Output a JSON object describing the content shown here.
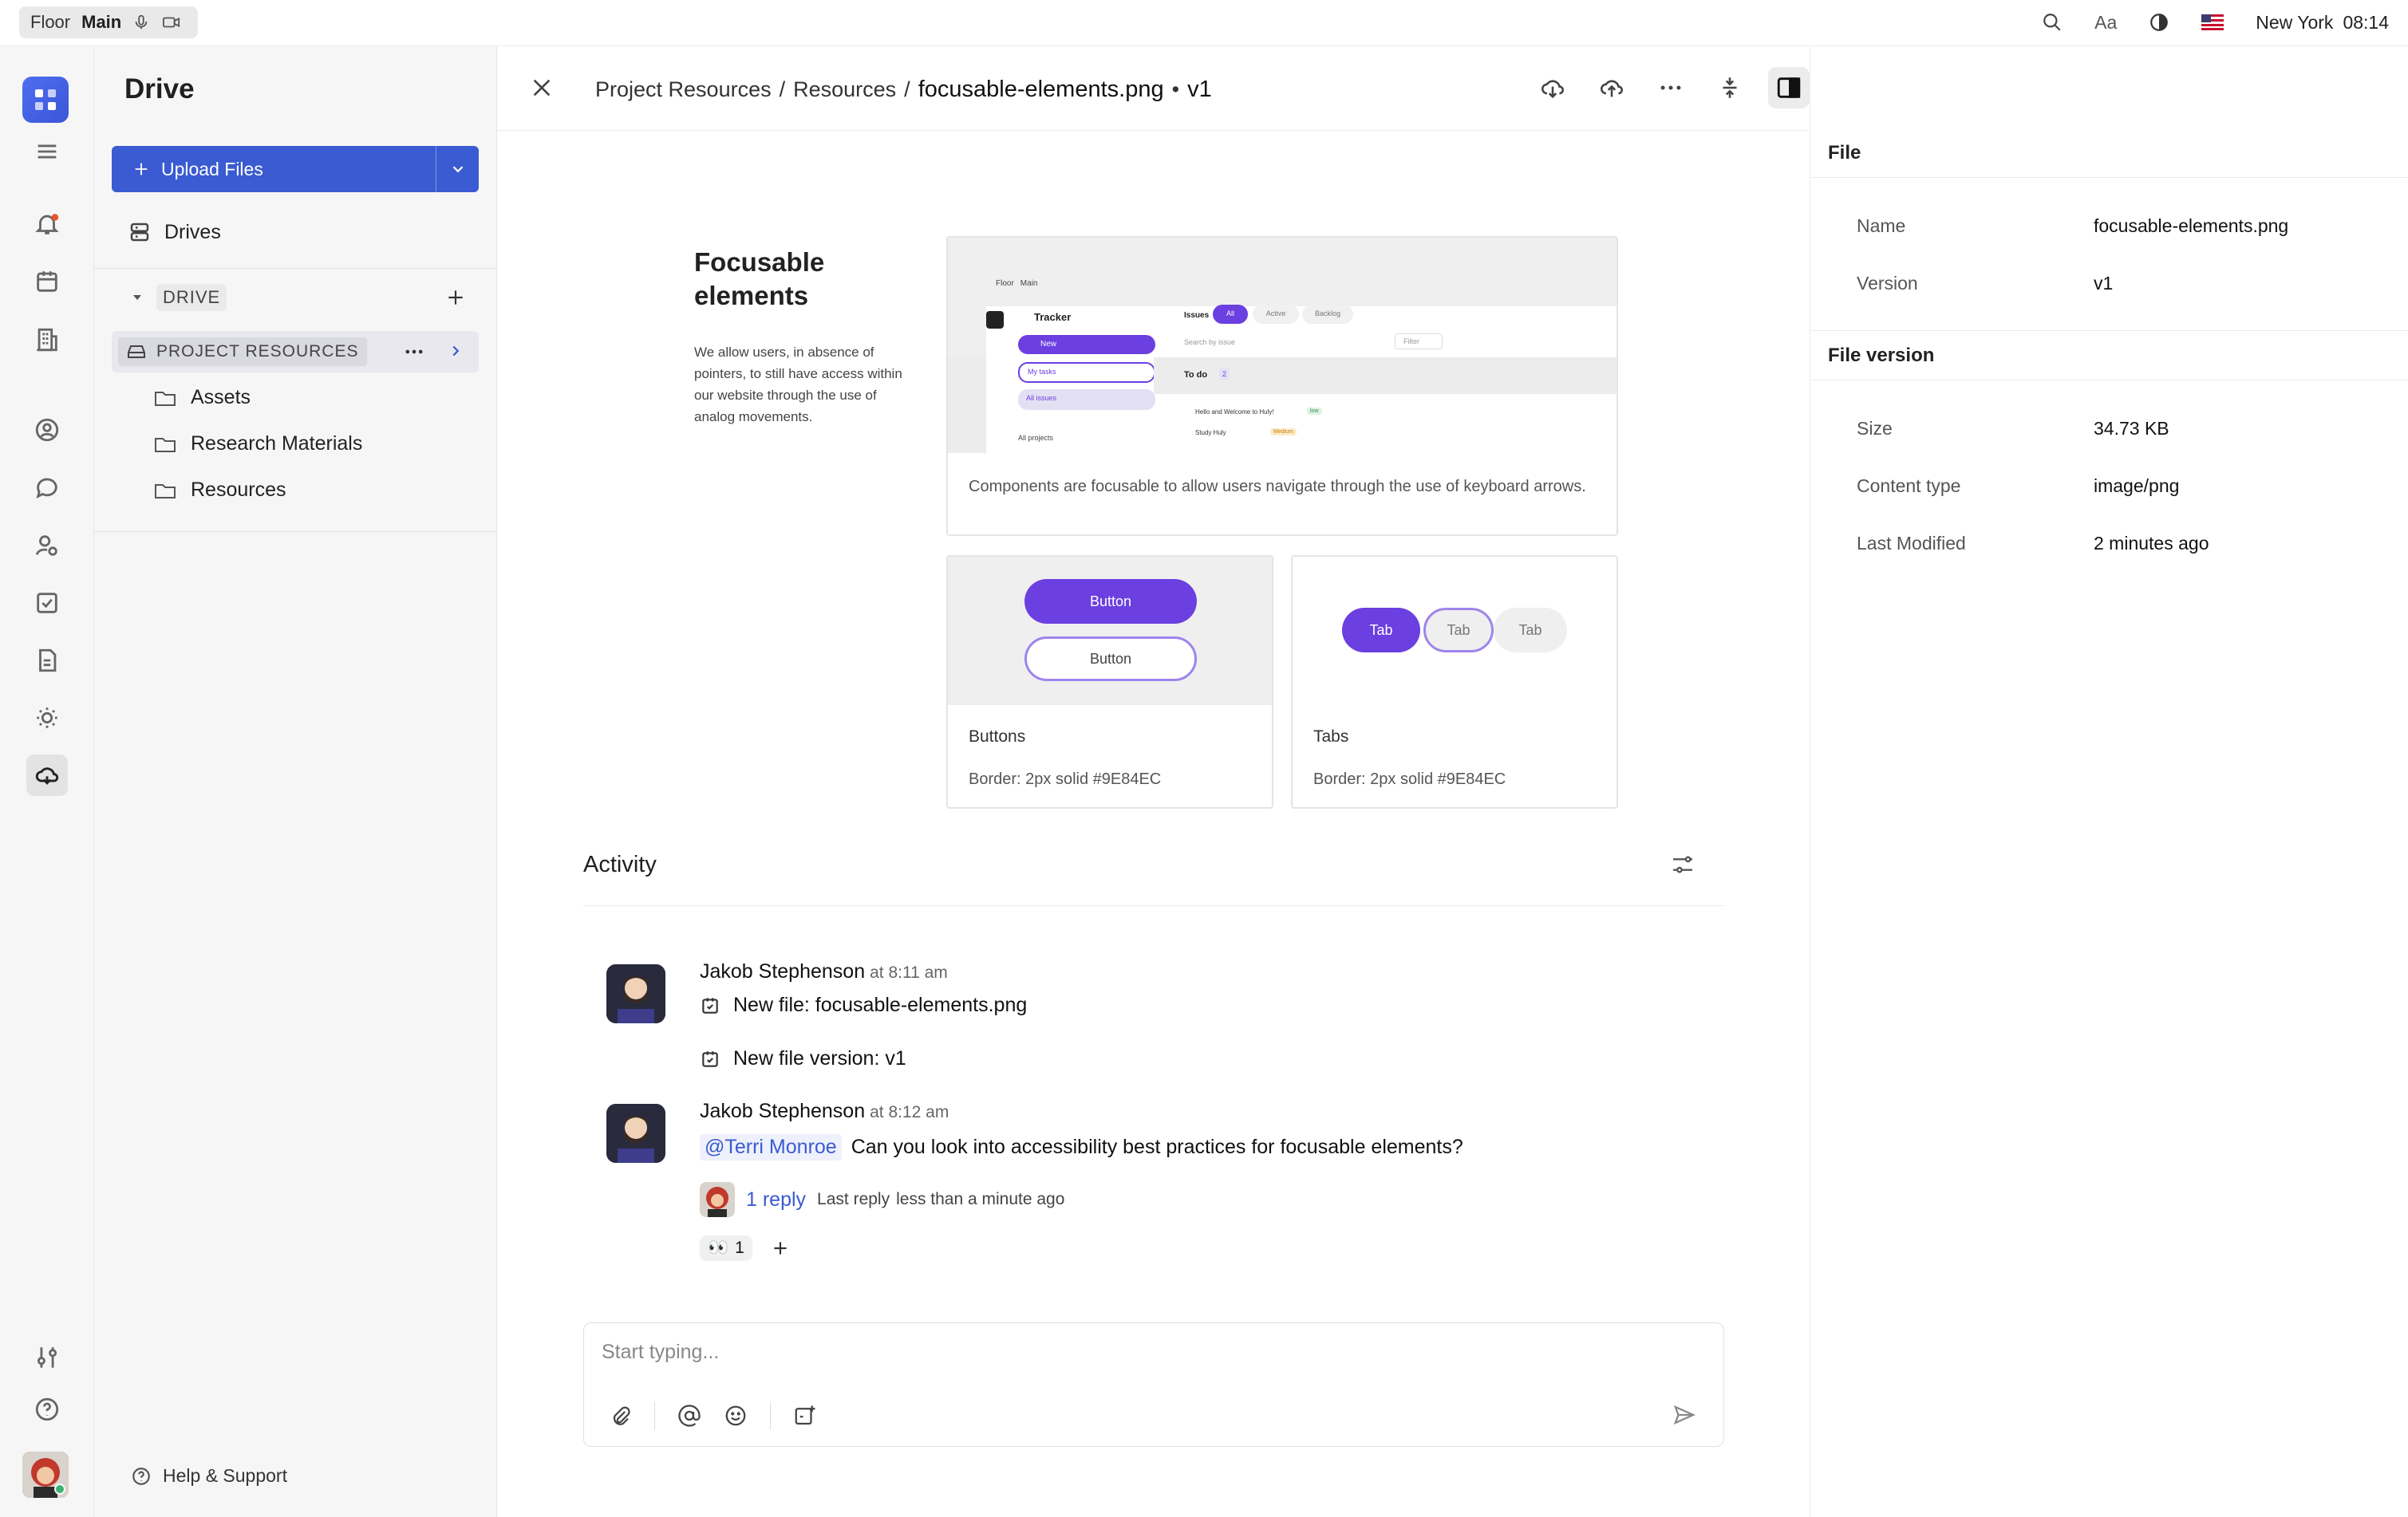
{
  "topbar": {
    "workspace": "Floor",
    "channel": "Main",
    "font_toggle": "Aa",
    "location": "New York",
    "time": "08:14"
  },
  "sidebar": {
    "title": "Drive",
    "upload_label": "Upload Files",
    "drives_label": "Drives",
    "drive_section": "DRIVE",
    "project": "PROJECT RESOURCES",
    "folders": [
      "Assets",
      "Research Materials",
      "Resources"
    ],
    "help": "Help & Support"
  },
  "header": {
    "crumb1": "Project Resources",
    "crumb2": "Resources",
    "filename": "focusable-elements.png",
    "version": "v1"
  },
  "preview": {
    "title_line1": "Focusable",
    "title_line2": "elements",
    "desc": "We allow users, in absence of pointers, to still have access within our website through the use of analog movements.",
    "card1_caption": "Components are focusable to allow users navigate through the use of keyboard arrows.",
    "mini_floor": "Floor",
    "mini_main": "Main",
    "mini_tracker": "Tracker",
    "mini_new": "New",
    "mini_mytasks": "My tasks",
    "mini_allissues": "All issues",
    "mini_allprojects": "All projects",
    "mini_issues": "Issues",
    "mini_all": "All",
    "mini_active": "Active",
    "mini_backlog": "Backlog",
    "mini_search": "Search by issue",
    "mini_filter": "Filter",
    "mini_todo": "To do",
    "mini_todo_count": "2",
    "mini_issue1": "Hello and Welcome to Huly!",
    "mini_issue1_tag": "low",
    "mini_issue2": "Study Huly",
    "mini_issue2_tag": "Medium",
    "buttons_title": "Buttons",
    "buttons_border": "Border: 2px solid #9E84EC",
    "button_label": "Button",
    "tabs_title": "Tabs",
    "tabs_border": "Border: 2px solid #9E84EC",
    "tab_label": "Tab"
  },
  "activity": {
    "title": "Activity",
    "msg1_name": "Jakob Stephenson",
    "msg1_time": "at 8:11 am",
    "msg1_line1": "New file: focusable-elements.png",
    "msg1_line2": "New file version: v1",
    "msg2_name": "Jakob Stephenson",
    "msg2_time": "at 8:12 am",
    "msg2_mention": "@Terri Monroe",
    "msg2_text": "Can you look into accessibility best practices for focusable elements?",
    "reply_count": "1 reply",
    "reply_meta": "Last reply",
    "reply_when": "less than a minute ago",
    "reaction": "👀",
    "reaction_count": "1",
    "composer_placeholder": "Start typing..."
  },
  "panel": {
    "file_section": "File",
    "name_label": "Name",
    "name_value": "focusable-elements.png",
    "version_label": "Version",
    "version_value": "v1",
    "fv_section": "File version",
    "size_label": "Size",
    "size_value": "34.73 KB",
    "type_label": "Content type",
    "type_value": "image/png",
    "mod_label": "Last Modified",
    "mod_value": "2 minutes ago"
  },
  "colors": {
    "accent": "#3a5bd1",
    "purple": "#6b3fe0",
    "purple_border": "#9E84EC"
  }
}
